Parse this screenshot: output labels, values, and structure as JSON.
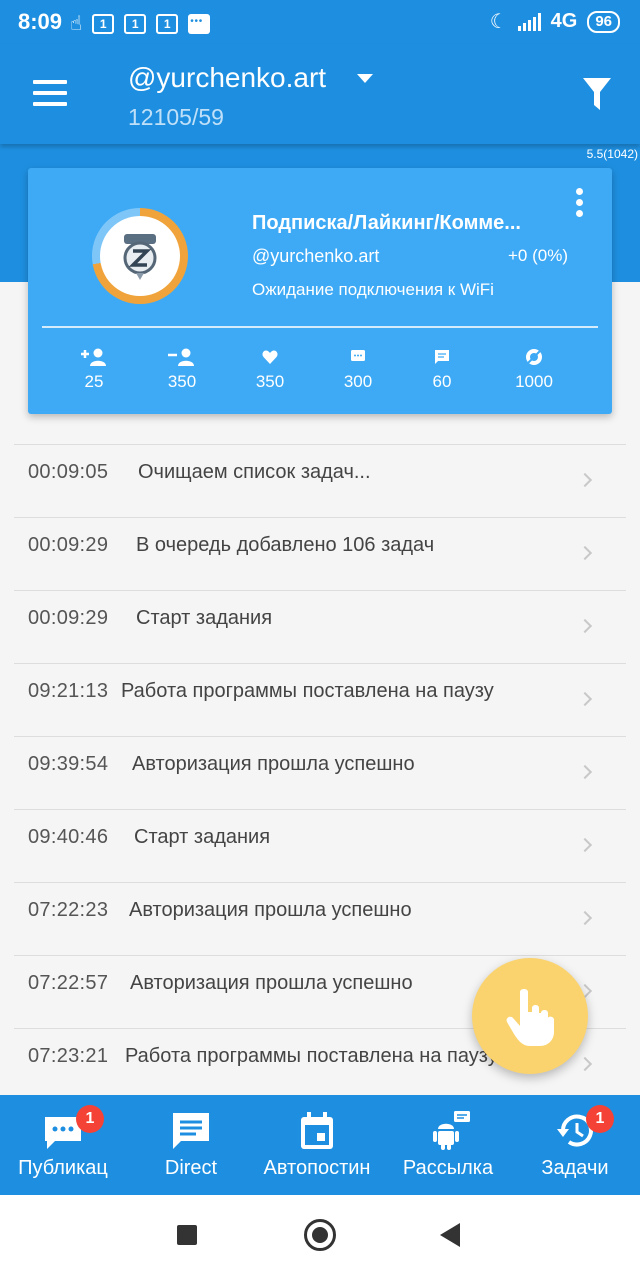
{
  "status_bar": {
    "time": "8:09",
    "sim_labels": [
      "1",
      "1",
      "1"
    ],
    "network": "4G",
    "battery": "96"
  },
  "header": {
    "account": "@yurchenko.art",
    "counts": "12105/59",
    "version": "5.5(1042)"
  },
  "card": {
    "title": "Подписка/Лайкинг/Комме...",
    "username": "@yurchenko.art",
    "delta": "+0 (0%)",
    "status": "Ожидание подключения к WiFi",
    "stats": [
      {
        "icon": "person-add-icon",
        "value": "25"
      },
      {
        "icon": "person-remove-icon",
        "value": "350"
      },
      {
        "icon": "heart-icon",
        "value": "350"
      },
      {
        "icon": "comment-icon",
        "value": "300"
      },
      {
        "icon": "message-icon",
        "value": "60"
      },
      {
        "icon": "eye-off-icon",
        "value": "1000"
      }
    ]
  },
  "log": [
    {
      "time": "00:09:05",
      "message": "Очищаем список задач..."
    },
    {
      "time": "00:09:29",
      "message": "В очередь добавлено 106 задач"
    },
    {
      "time": "00:09:29",
      "message": "Старт задания"
    },
    {
      "time": "09:21:13",
      "message": "Работа программы поставлена на паузу"
    },
    {
      "time": "09:39:54",
      "message": "Авторизация прошла успешно"
    },
    {
      "time": "09:40:46",
      "message": "Старт задания"
    },
    {
      "time": "07:22:23",
      "message": "Авторизация прошла успешно"
    },
    {
      "time": "07:22:57",
      "message": "Авторизация прошла успешно"
    },
    {
      "time": "07:23:21",
      "message": "Работа программы поставлена на паузу"
    }
  ],
  "bottom_nav": [
    {
      "label": "Публикац",
      "icon": "publish-chat-icon",
      "badge": "1"
    },
    {
      "label": "Direct",
      "icon": "direct-message-icon",
      "badge": ""
    },
    {
      "label": "Автопостин",
      "icon": "calendar-icon",
      "badge": ""
    },
    {
      "label": "Рассылка",
      "icon": "android-icon",
      "badge": ""
    },
    {
      "label": "Задачи",
      "icon": "history-icon",
      "badge": "1"
    }
  ],
  "colors": {
    "primary": "#1e8fe0",
    "card": "#3eaaf5",
    "fab": "#fad36e",
    "badge": "#f44336"
  }
}
